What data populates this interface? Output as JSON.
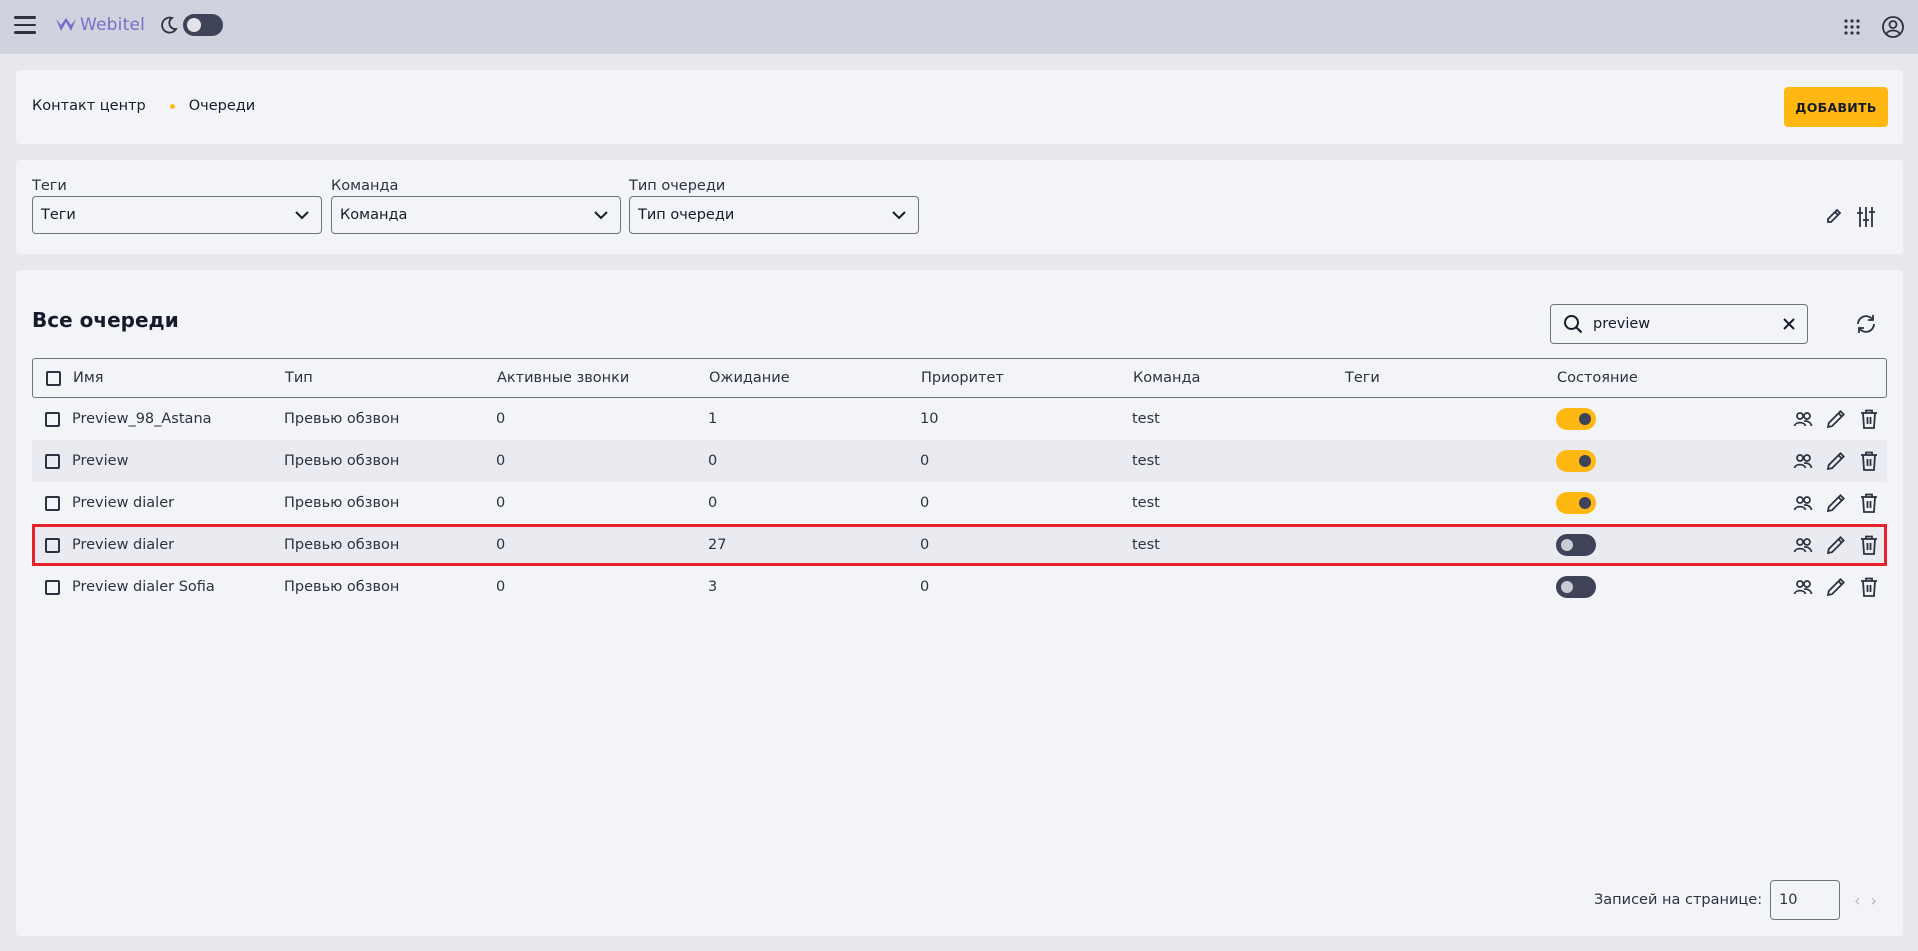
{
  "header": {
    "logo_text": "Webitel",
    "icons": [
      "menu-icon",
      "webitel-logo-icon",
      "moon-icon",
      "apps-grid-icon",
      "account-icon"
    ]
  },
  "breadcrumb": {
    "root": "Контакт центр",
    "current": "Очереди"
  },
  "toolbar": {
    "add_label": "ДОБАВИТЬ"
  },
  "filters": [
    {
      "label": "Теги",
      "value": "Теги"
    },
    {
      "label": "Команда",
      "value": "Команда"
    },
    {
      "label": "Тип очереди",
      "value": "Тип очереди"
    }
  ],
  "list": {
    "title": "Все очереди",
    "search_value": "preview"
  },
  "table": {
    "columns": [
      "Имя",
      "Тип",
      "Активные звонки",
      "Ожидание",
      "Приоритет",
      "Команда",
      "Теги",
      "Состояние"
    ],
    "rows": [
      {
        "name": "Preview_98_Astana",
        "type": "Превью обзвон",
        "active": "0",
        "waiting": "1",
        "priority": "10",
        "team": "test",
        "tags": "",
        "enabled": true
      },
      {
        "name": "Preview",
        "type": "Превью обзвон",
        "active": "0",
        "waiting": "0",
        "priority": "0",
        "team": "test",
        "tags": "",
        "enabled": true
      },
      {
        "name": "Preview dialer",
        "type": "Превью обзвон",
        "active": "0",
        "waiting": "0",
        "priority": "0",
        "team": "test",
        "tags": "",
        "enabled": true
      },
      {
        "name": "Preview dialer",
        "type": "Превью обзвон",
        "active": "0",
        "waiting": "27",
        "priority": "0",
        "team": "test",
        "tags": "",
        "enabled": false,
        "highlighted": true
      },
      {
        "name": "Preview dialer Sofia",
        "type": "Превью обзвон",
        "active": "0",
        "waiting": "3",
        "priority": "0",
        "team": "",
        "tags": "",
        "enabled": false
      }
    ]
  },
  "pagination": {
    "label": "Записей на странице:",
    "size": "10"
  },
  "colors": {
    "accent": "#ffb812",
    "highlight_border": "#e8212a",
    "toggle_off": "#3e4357"
  }
}
